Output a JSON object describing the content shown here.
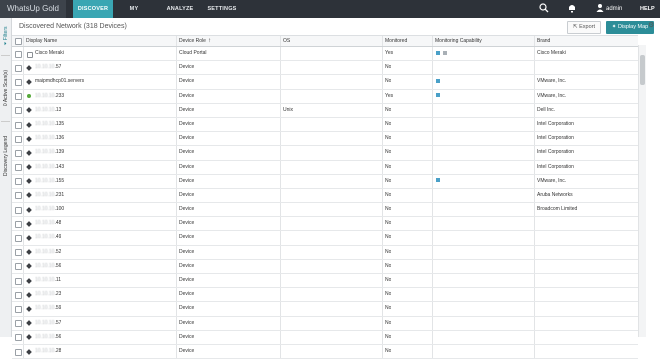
{
  "app": {
    "logo": "WhatsUp Gold"
  },
  "nav": {
    "tabs": [
      "DISCOVER",
      "MY NETWORK",
      "ANALYZE",
      "SETTINGS"
    ],
    "active": "DISCOVER"
  },
  "top_right": {
    "user": "admin",
    "help": "HELP",
    "search_icon": "search-icon",
    "bell_icon": "bell-icon",
    "user_icon": "user-icon"
  },
  "sidebar": {
    "tabs": [
      "Filters",
      "0 Active Scan(s)",
      "Discovery Legend"
    ]
  },
  "header": {
    "title": "Discovered Network",
    "count": "(318 Devices)",
    "export_label": "Export",
    "display_map_label": "Display Map"
  },
  "table": {
    "columns": [
      "Display Name",
      "Device Role",
      "OS",
      "Monitored",
      "Monitoring Capability",
      "Brand"
    ],
    "rows": [
      {
        "name": "Cisco Meraki",
        "name_blur": "",
        "icon": "ghost",
        "role": "Cloud Portal",
        "os": "",
        "monitored": "Yes",
        "cap": [
          "upload-icon",
          "network-icon"
        ],
        "brand": "Cisco Meraki"
      },
      {
        "name": ".57",
        "name_blur": "10.10.10",
        "icon": "diamond",
        "role": "Device",
        "os": "",
        "monitored": "No",
        "cap": [],
        "brand": ""
      },
      {
        "name": "maipmdhcp01.servers",
        "name_blur": "",
        "icon": "diamond",
        "role": "Device",
        "os": "",
        "monitored": "No",
        "cap": [
          "vm-icon"
        ],
        "brand": "VMware, Inc."
      },
      {
        "name": ".233",
        "name_blur": "10.10.10",
        "icon": "green",
        "role": "Device",
        "os": "",
        "monitored": "Yes",
        "cap": [
          "vm-icon"
        ],
        "brand": "VMware, Inc."
      },
      {
        "name": ".13",
        "name_blur": "10.10.10",
        "icon": "diamond",
        "role": "Device",
        "os": "Unix",
        "monitored": "No",
        "cap": [],
        "brand": "Dell Inc."
      },
      {
        "name": ".135",
        "name_blur": "10.10.10",
        "icon": "diamond",
        "role": "Device",
        "os": "",
        "monitored": "No",
        "cap": [],
        "brand": "Intel Corporation"
      },
      {
        "name": ".136",
        "name_blur": "10.10.10",
        "icon": "diamond",
        "role": "Device",
        "os": "",
        "monitored": "No",
        "cap": [],
        "brand": "Intel Corporation"
      },
      {
        "name": ".139",
        "name_blur": "10.10.10",
        "icon": "diamond",
        "role": "Device",
        "os": "",
        "monitored": "No",
        "cap": [],
        "brand": "Intel Corporation"
      },
      {
        "name": ".143",
        "name_blur": "10.10.10",
        "icon": "diamond",
        "role": "Device",
        "os": "",
        "monitored": "No",
        "cap": [],
        "brand": "Intel Corporation"
      },
      {
        "name": ".155",
        "name_blur": "10.10.10",
        "icon": "diamond",
        "role": "Device",
        "os": "",
        "monitored": "No",
        "cap": [
          "vm-icon"
        ],
        "brand": "VMware, Inc."
      },
      {
        "name": ".231",
        "name_blur": "10.10.10",
        "icon": "diamond",
        "role": "Device",
        "os": "",
        "monitored": "No",
        "cap": [],
        "brand": "Aruba Networks"
      },
      {
        "name": ".100",
        "name_blur": "10.10.10",
        "icon": "diamond",
        "role": "Device",
        "os": "",
        "monitored": "No",
        "cap": [],
        "brand": "Broadcom Limited"
      },
      {
        "name": ".48",
        "name_blur": "10.10.10",
        "icon": "diamond",
        "role": "Device",
        "os": "",
        "monitored": "No",
        "cap": [],
        "brand": ""
      },
      {
        "name": ".49",
        "name_blur": "10.10.10",
        "icon": "diamond",
        "role": "Device",
        "os": "",
        "monitored": "No",
        "cap": [],
        "brand": ""
      },
      {
        "name": ".52",
        "name_blur": "10.10.10",
        "icon": "diamond",
        "role": "Device",
        "os": "",
        "monitored": "No",
        "cap": [],
        "brand": ""
      },
      {
        "name": ".56",
        "name_blur": "10.10.10",
        "icon": "diamond",
        "role": "Device",
        "os": "",
        "monitored": "No",
        "cap": [],
        "brand": ""
      },
      {
        "name": ".11",
        "name_blur": "10.10.10",
        "icon": "diamond",
        "role": "Device",
        "os": "",
        "monitored": "No",
        "cap": [],
        "brand": ""
      },
      {
        "name": ".23",
        "name_blur": "10.10.10",
        "icon": "diamond",
        "role": "Device",
        "os": "",
        "monitored": "No",
        "cap": [],
        "brand": ""
      },
      {
        "name": ".59",
        "name_blur": "10.10.10",
        "icon": "diamond",
        "role": "Device",
        "os": "",
        "monitored": "No",
        "cap": [],
        "brand": ""
      },
      {
        "name": ".57",
        "name_blur": "10.10.10",
        "icon": "diamond",
        "role": "Device",
        "os": "",
        "monitored": "No",
        "cap": [],
        "brand": ""
      },
      {
        "name": ".56",
        "name_blur": "10.10.10",
        "icon": "diamond",
        "role": "Device",
        "os": "",
        "monitored": "No",
        "cap": [],
        "brand": ""
      },
      {
        "name": ".28",
        "name_blur": "10.10.10",
        "icon": "diamond",
        "role": "Device",
        "os": "",
        "monitored": "No",
        "cap": [],
        "brand": ""
      }
    ]
  },
  "colors": {
    "topbar": "#2d3239",
    "accent": "#3aa6b3",
    "button_primary": "#2c8d98"
  }
}
